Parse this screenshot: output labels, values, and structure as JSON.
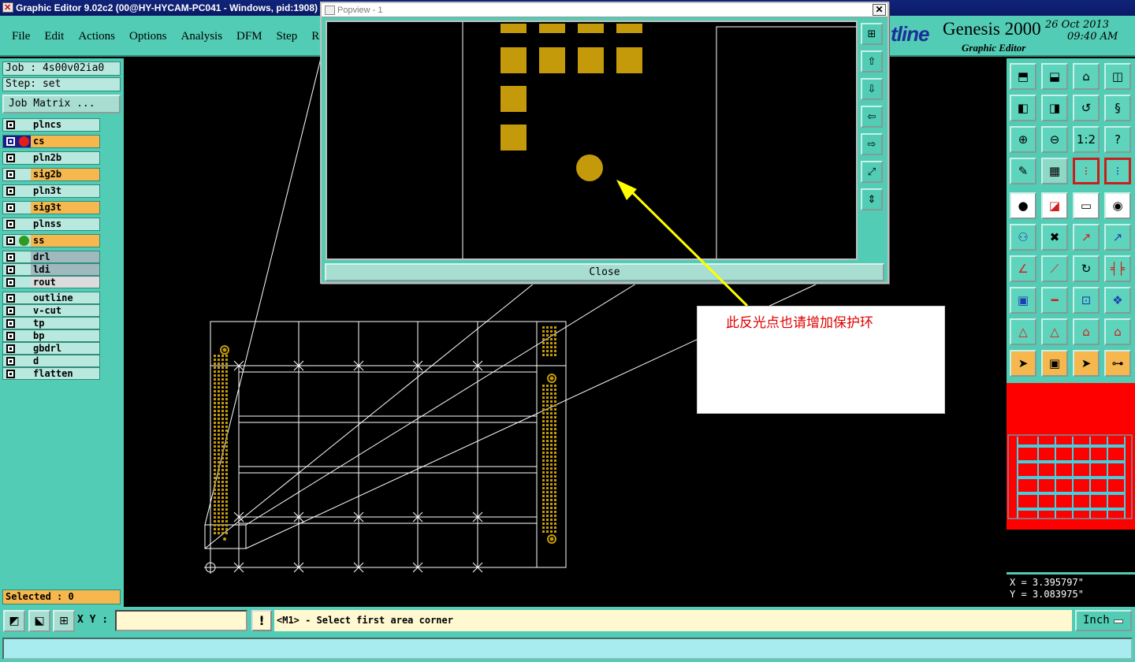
{
  "window": {
    "title": "Graphic Editor 9.02c2 (00@HY-HYCAM-PC041 - Windows, pid:1908)"
  },
  "menu": [
    "File",
    "Edit",
    "Actions",
    "Options",
    "Analysis",
    "DFM",
    "Step",
    "Ro"
  ],
  "brand": {
    "logo": "tline",
    "product": "Genesis 2000",
    "subtitle": "Graphic Editor",
    "date": "26 Oct 2013",
    "time": "09:40 AM"
  },
  "job": {
    "job_line": "Job : 4s00v02ia0",
    "step_line": "Step: set",
    "matrix_button": "Job Matrix ..."
  },
  "layers": [
    {
      "name": "plncs",
      "type": "board"
    },
    {
      "name": "cs",
      "type": "signal",
      "marker": "red"
    },
    {
      "name": "pln2b",
      "type": "board"
    },
    {
      "name": "sig2b",
      "type": "signal"
    },
    {
      "name": "pln3t",
      "type": "board"
    },
    {
      "name": "sig3t",
      "type": "signal"
    },
    {
      "name": "plnss",
      "type": "board"
    },
    {
      "name": "ss",
      "type": "signal",
      "marker": "green"
    },
    {
      "name": "drl",
      "type": "drill"
    },
    {
      "name": "ldi",
      "type": "drill"
    },
    {
      "name": "rout",
      "type": "rout"
    },
    {
      "name": "outline",
      "type": "misc"
    },
    {
      "name": "v-cut",
      "type": "misc"
    },
    {
      "name": "tp",
      "type": "misc"
    },
    {
      "name": "bp",
      "type": "misc"
    },
    {
      "name": "gbdrl",
      "type": "misc"
    },
    {
      "name": "d",
      "type": "misc"
    },
    {
      "name": "flatten",
      "type": "misc"
    }
  ],
  "selected": "Selected : 0",
  "popview": {
    "title": "Popview - 1",
    "close_label": "Close"
  },
  "annotation": {
    "text": "此反光点也请增加保护环",
    "arrow_color": "#ffff00"
  },
  "colors": {
    "panel": "#52ccb4",
    "pad": "#c49a0a",
    "annotation_text": "#e00000",
    "overview_bg": "#ff0000",
    "overview_grid": "#40d0e0"
  },
  "coords": {
    "x": "X = 3.395797\"",
    "y": "Y = 3.083975\""
  },
  "bottom": {
    "xy_label": "X Y :",
    "xy_value": "",
    "prompt": "<M1> - Select first area corner",
    "units": "Inch"
  }
}
